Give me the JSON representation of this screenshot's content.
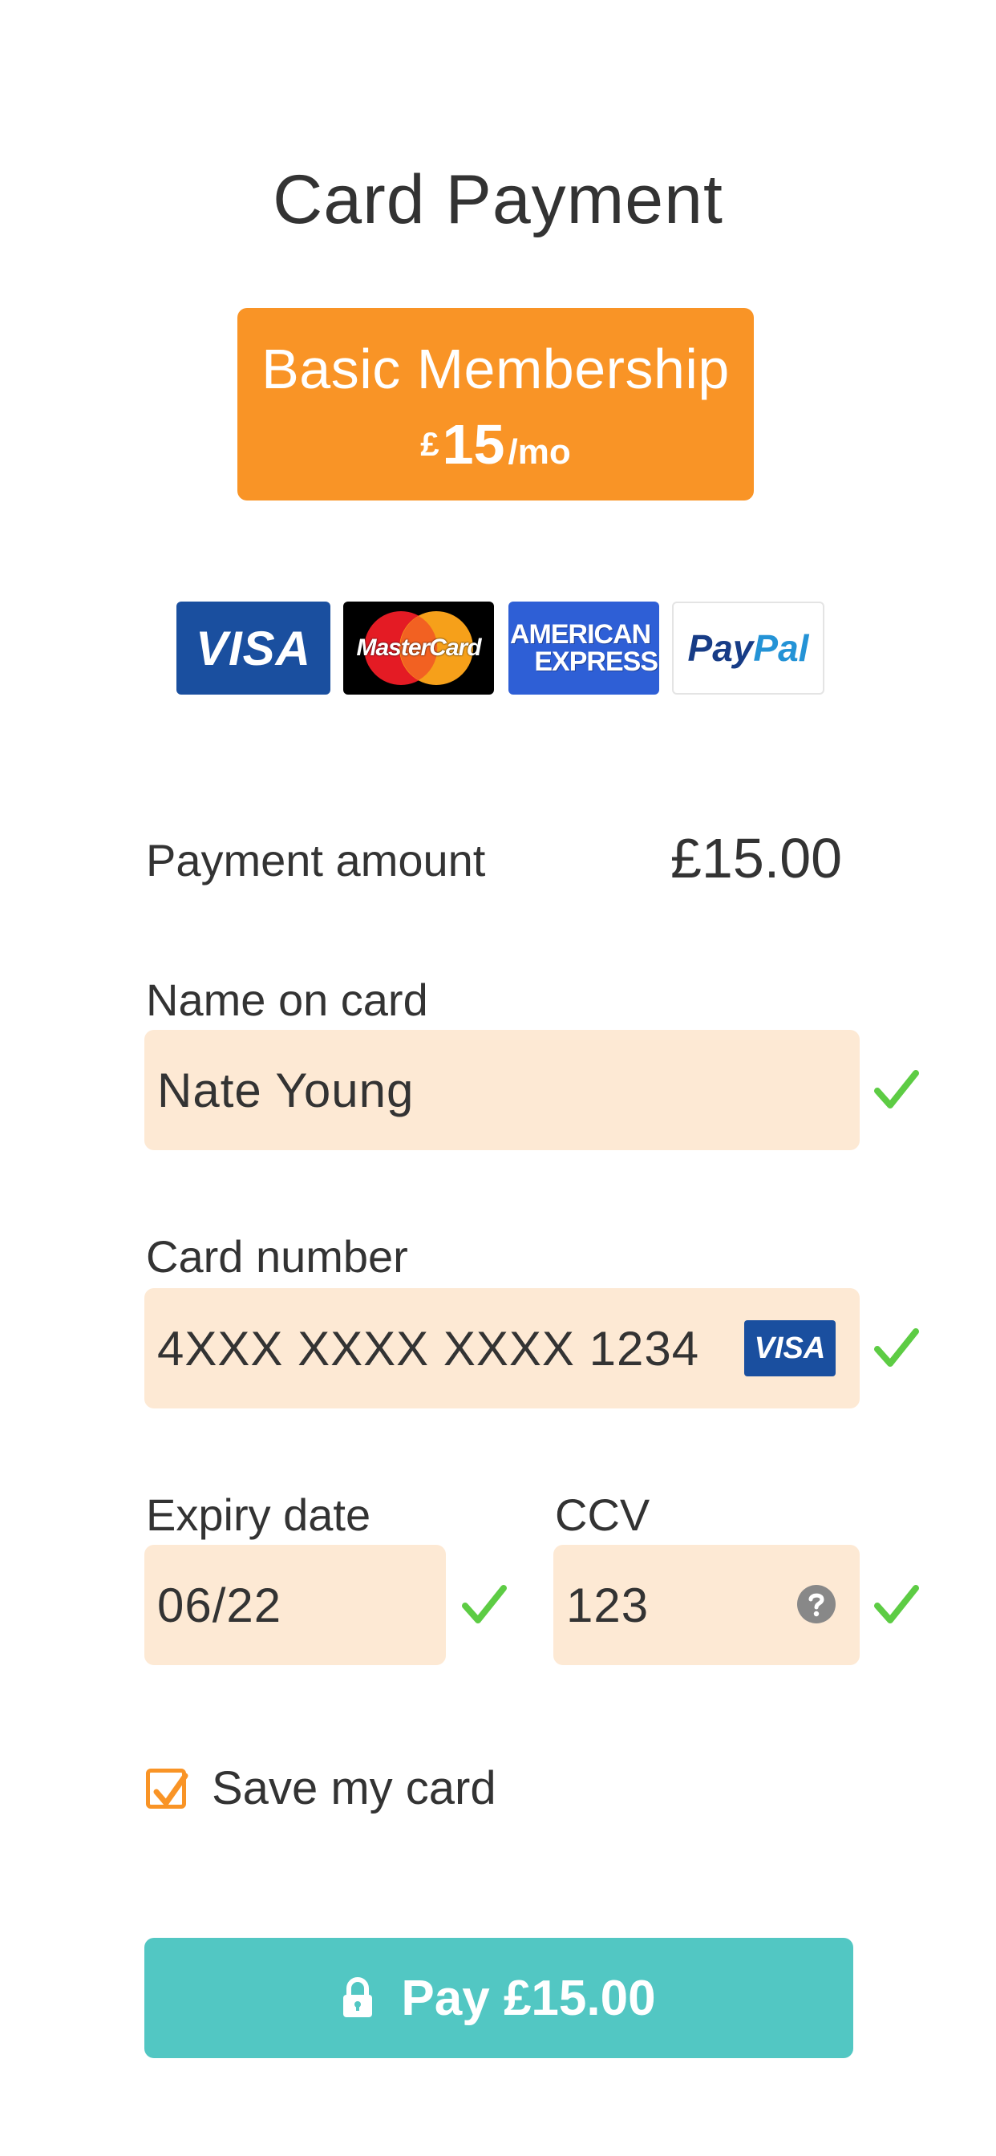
{
  "header": {
    "title": "Card Payment"
  },
  "plan": {
    "name": "Basic Membership",
    "currency_symbol": "£",
    "price": "15",
    "period": "/mo",
    "color": "#f99426"
  },
  "card_logos": {
    "visa": "VISA",
    "mastercard": "MasterCard",
    "amex_line1": "AMERICAN",
    "amex_line2": "EXPRESS",
    "paypal_pay": "Pay",
    "paypal_pal": "Pal"
  },
  "payment": {
    "amount_label": "Payment amount",
    "amount_value": "£15.00"
  },
  "form": {
    "name": {
      "label": "Name on card",
      "value": "Nate Young",
      "valid": true
    },
    "card_number": {
      "label": "Card number",
      "value": "4XXX XXXX XXXX 1234",
      "brand_badge": "VISA",
      "valid": true
    },
    "expiry": {
      "label": "Expiry date",
      "value": "06/22",
      "valid": true
    },
    "ccv": {
      "label": "CCV",
      "value": "123",
      "help_icon": "question-circle-icon",
      "valid": true
    },
    "save_card": {
      "label": "Save my card",
      "checked": true
    }
  },
  "pay_button": {
    "label": "Pay £15.00",
    "icon": "lock-icon",
    "color": "#52c7c3"
  },
  "colors": {
    "accent": "#f99426",
    "field_bg": "#fde9d4",
    "valid_check": "#5dcc44",
    "text": "#333333"
  }
}
